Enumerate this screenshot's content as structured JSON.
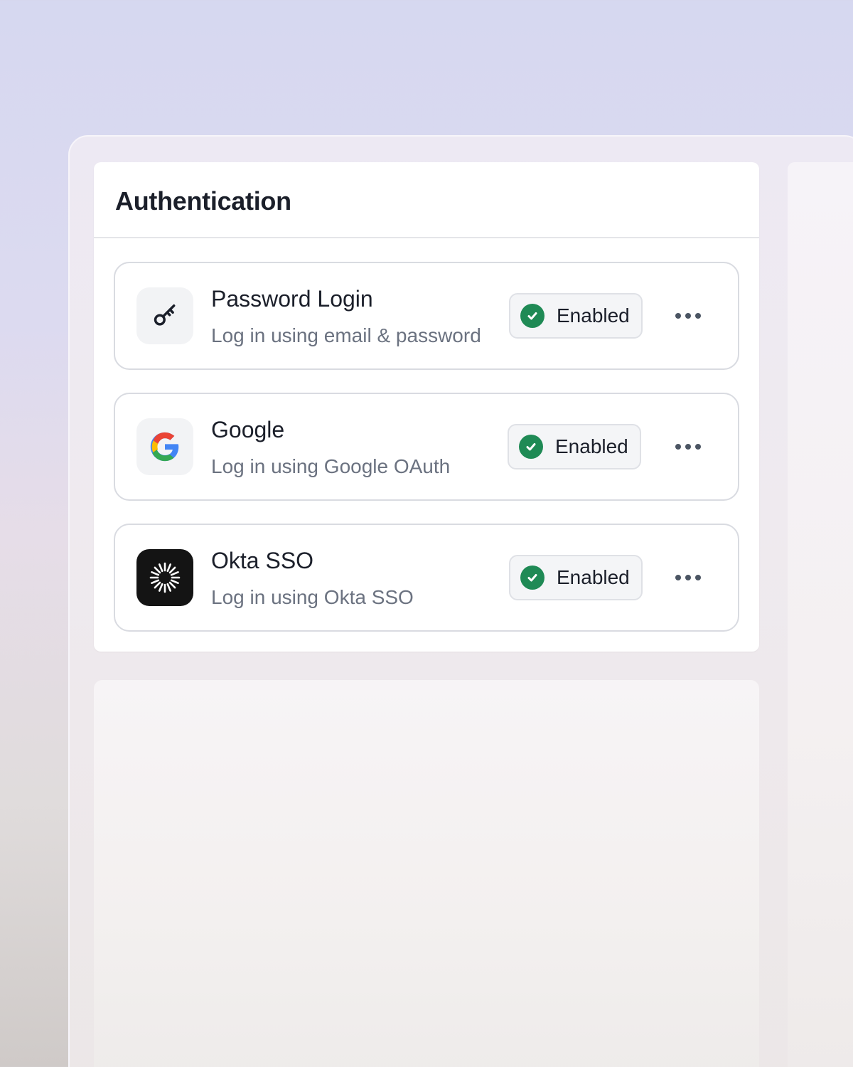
{
  "auth": {
    "title": "Authentication",
    "methods": [
      {
        "name": "Password Login",
        "description": "Log in using email & password",
        "status": "Enabled",
        "icon": "key-icon"
      },
      {
        "name": "Google",
        "description": "Log in using Google OAuth",
        "status": "Enabled",
        "icon": "google-icon"
      },
      {
        "name": "Okta SSO",
        "description": "Log in using Okta SSO",
        "status": "Enabled",
        "icon": "okta-icon"
      }
    ]
  },
  "colors": {
    "status_green": "#1f8a55",
    "title_text": "#1b1f2a",
    "muted_text": "#6b7280",
    "okta_bg": "#141414"
  }
}
